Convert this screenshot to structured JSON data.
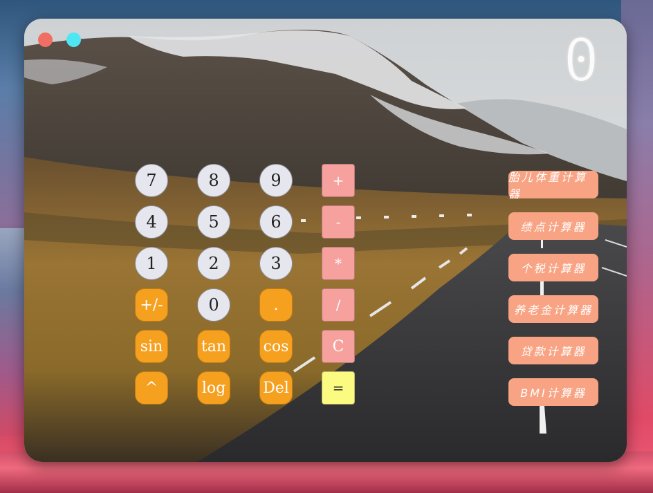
{
  "display": {
    "value": "0"
  },
  "window_controls": [
    "close",
    "minimize"
  ],
  "keypad": {
    "rows": [
      [
        "7",
        "8",
        "9",
        "+"
      ],
      [
        "4",
        "5",
        "6",
        "-"
      ],
      [
        "1",
        "2",
        "3",
        "*"
      ],
      [
        "+/-",
        "0",
        ".",
        "/"
      ],
      [
        "sin",
        "tan",
        "cos",
        "C"
      ],
      [
        "^",
        "log",
        "Del",
        "="
      ]
    ]
  },
  "side_buttons": [
    "胎儿体重计算器",
    "绩点计算器",
    "个税计算器",
    "养老金计算器",
    "贷款计算器",
    "BMI计算器"
  ],
  "colors": {
    "number_key": "#e6e6ee",
    "function_key": "#f6a020",
    "operator_key": "#f6a19d",
    "equals_key": "#fbfb82",
    "side_button": "#f8a383",
    "close_dot": "#f06e62",
    "minimize_dot": "#4fe6f4"
  }
}
